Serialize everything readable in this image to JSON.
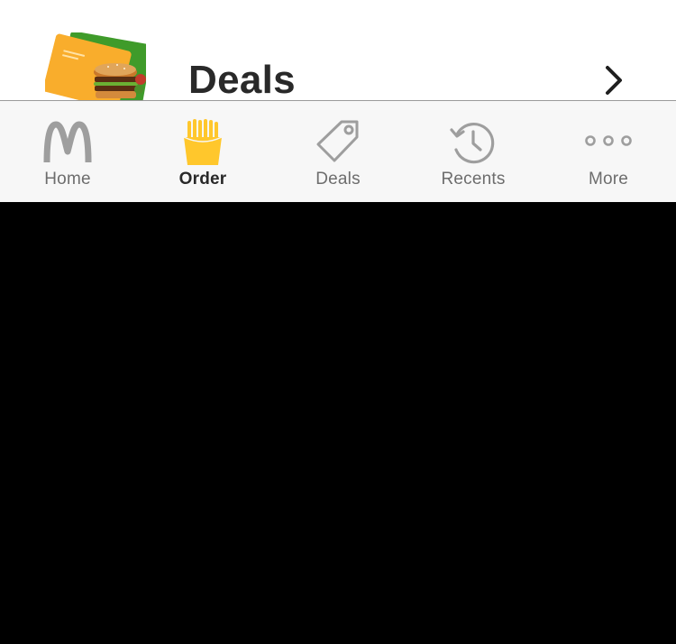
{
  "deals_row": {
    "title": "Deals",
    "thumbnail_icon": "deals-burger-card-image",
    "chevron_icon": "chevron-right-icon"
  },
  "tabbar": {
    "active_tab": "order",
    "tabs": [
      {
        "id": "home",
        "label": "Home",
        "icon": "golden-arches-icon"
      },
      {
        "id": "order",
        "label": "Order",
        "icon": "fries-icon"
      },
      {
        "id": "deals",
        "label": "Deals",
        "icon": "tag-icon"
      },
      {
        "id": "recents",
        "label": "Recents",
        "icon": "history-icon"
      },
      {
        "id": "more",
        "label": "More",
        "icon": "more-dots-icon"
      }
    ]
  },
  "colors": {
    "active_icon": "#FFC72C",
    "inactive_icon": "#9e9e9e",
    "active_label": "#292929",
    "inactive_label": "#6d6d6d",
    "tabbar_bg": "#f7f7f7"
  }
}
